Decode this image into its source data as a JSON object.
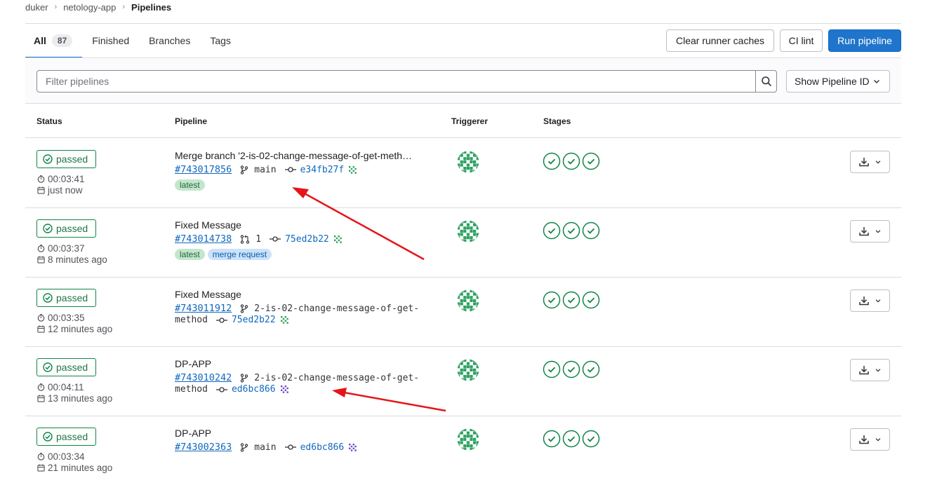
{
  "breadcrumb": {
    "items": [
      "duker",
      "netology-app"
    ],
    "current": "Pipelines"
  },
  "tabs": [
    {
      "label": "All",
      "count": "87"
    },
    {
      "label": "Finished"
    },
    {
      "label": "Branches"
    },
    {
      "label": "Tags"
    }
  ],
  "actions": {
    "clear_caches": "Clear runner caches",
    "ci_lint": "CI lint",
    "run_pipeline": "Run pipeline"
  },
  "filter": {
    "placeholder": "Filter pipelines",
    "show_id": "Show Pipeline ID"
  },
  "columns": {
    "status": "Status",
    "pipeline": "Pipeline",
    "triggerer": "Triggerer",
    "stages": "Stages"
  },
  "colors": {
    "primary": "#1f75cb",
    "success": "#108548",
    "annotation": "#e4161b"
  },
  "pipelines": [
    {
      "status": "passed",
      "duration": "00:03:41",
      "finished": "just now",
      "title": "Merge branch '2-is-02-change-message-of-get-meth…",
      "id": "#743017856",
      "ref_icon": "branch-icon",
      "ref": "main",
      "ref_cont": "",
      "sha": "e34fb27f",
      "labels": [
        "latest"
      ]
    },
    {
      "status": "passed",
      "duration": "00:03:37",
      "finished": "8 minutes ago",
      "title": "Fixed Message",
      "id": "#743014738",
      "ref_icon": "merge-request-icon",
      "ref": "1",
      "ref_cont": "",
      "sha": "75ed2b22",
      "labels": [
        "latest",
        "merge request"
      ]
    },
    {
      "status": "passed",
      "duration": "00:03:35",
      "finished": "12 minutes ago",
      "title": "Fixed Message",
      "id": "#743011912",
      "ref_icon": "branch-icon",
      "ref": "2-is-02-change-message-of-get-",
      "ref_cont": "method",
      "sha": "75ed2b22",
      "labels": []
    },
    {
      "status": "passed",
      "duration": "00:04:11",
      "finished": "13 minutes ago",
      "title": "DP-APP",
      "id": "#743010242",
      "ref_icon": "branch-icon",
      "ref": "2-is-02-change-message-of-get-",
      "ref_cont": "method",
      "sha": "ed6bc866",
      "labels": []
    },
    {
      "status": "passed",
      "duration": "00:03:34",
      "finished": "21 minutes ago",
      "title": "DP-APP",
      "id": "#743002363",
      "ref_icon": "branch-icon",
      "ref": "main",
      "ref_cont": "",
      "sha": "ed6bc866",
      "labels": []
    }
  ]
}
